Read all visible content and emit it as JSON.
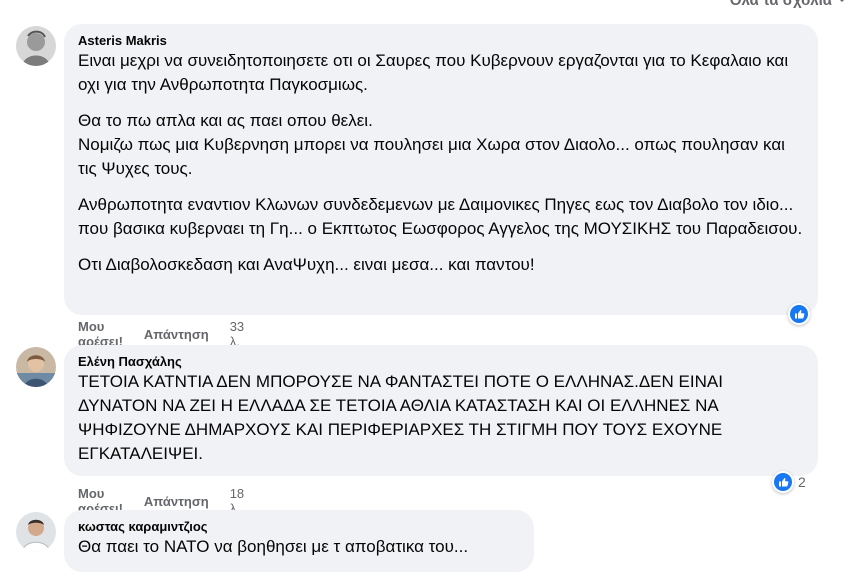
{
  "header": {
    "sort_label": "Όλα τα σχόλια"
  },
  "colors": {
    "like_blue": "#1877f2",
    "bubble": "#f0f2f5",
    "meta": "#65676b"
  },
  "comments": [
    {
      "author": "Asteris Makris",
      "paragraphs": [
        "Ειναι μεχρι να συνειδητοποιησετε οτι οι Σαυρες που Κυβερνουν εργαζονται για το Κεφαλαιο και οχι για την Ανθρωποτητα Παγκοσμιως.",
        "Θα το πω απλα και ας παει οπου θελει.\nΝομιζω πως μια Κυβερνηση μπορει να πουλησει μια Χωρα στον Διαολο... οπως πουλησαν και τις Ψυχες τους.",
        "Ανθρωποτητα εναντιον Κλωνων συνδεδεμενων με Δαιμονικες Πηγες εως τον Διαβολο τον ιδιο... που βασικα κυβερναει τη Γη... ο Εκπτωτος Εωσφορος Αγγελος της ΜΟΥΣΙΚΗΣ του Παραδεισου.",
        "Οτι Διαβολοσκεδαση και ΑναΨυχη... ειναι μεσα... και παντου!"
      ],
      "like_label": "Μου αρέσει!",
      "reply_label": "Απάντηση",
      "time": "33 λ.",
      "reactions": {
        "icon": "like-icon",
        "count": ""
      }
    },
    {
      "author": "Ελένη Πασχάλης",
      "paragraphs": [
        "ΤΕΤΟΙΑ ΚΑΤΝΤΙΑ ΔΕΝ ΜΠΟΡΟΥΣΕ ΝΑ ΦΑΝΤΑΣΤΕΙ ΠΟΤΕ Ο ΕΛΛΗΝΑΣ.ΔΕΝ ΕΙΝΑΙ ΔΥΝΑΤΟΝ ΝΑ ΖΕΙ Η ΕΛΛΑΔΑ ΣΕ ΤΕΤΟΙΑ ΑΘΛΙΑ ΚΑΤΑΣΤΑΣΗ ΚΑΙ ΟΙ ΕΛΛΗΝΕΣ ΝΑ ΨΗΦΙΖΟΥΝΕ ΔΗΜΑΡΧΟΥΣ ΚΑΙ ΠΕΡΙΦΕΡΙΑΡΧΕΣ ΤΗ ΣΤΙΓΜΗ ΠΟΥ ΤΟΥΣ ΕΧΟΥΝΕ ΕΓΚΑΤΑΛΕΙΨΕΙ."
      ],
      "like_label": "Μου αρέσει!",
      "reply_label": "Απάντηση",
      "time": "18 λ.",
      "reactions": {
        "icon": "like-icon",
        "count": "2"
      }
    },
    {
      "author": "κωστας καραμιντζιος",
      "paragraphs": [
        "Θα παει το ΝΑΤΟ να βοηθησει με τ αποβατικα του..."
      ]
    }
  ]
}
